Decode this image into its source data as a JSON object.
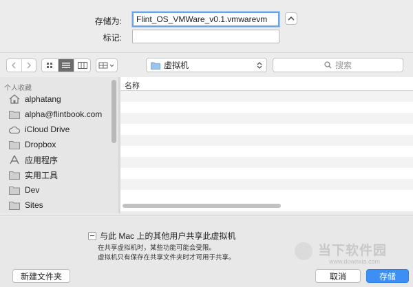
{
  "save": {
    "save_as_label": "存储为:",
    "save_as_value": "Flint_OS_VMWare_v0.1.vmwarevm",
    "tags_label": "标记:",
    "tags_value": ""
  },
  "toolbar": {
    "location": "虚拟机",
    "search_placeholder": "搜索"
  },
  "sidebar": {
    "section": "个人收藏",
    "items": [
      {
        "label": "alphatang",
        "icon": "home-icon"
      },
      {
        "label": "alpha@flintbook.com",
        "icon": "folder-icon"
      },
      {
        "label": "iCloud Drive",
        "icon": "cloud-icon"
      },
      {
        "label": "Dropbox",
        "icon": "folder-icon"
      },
      {
        "label": "应用程序",
        "icon": "applications-icon"
      },
      {
        "label": "实用工具",
        "icon": "folder-icon"
      },
      {
        "label": "Dev",
        "icon": "folder-icon"
      },
      {
        "label": "Sites",
        "icon": "folder-icon"
      }
    ]
  },
  "list": {
    "column_name": "名称"
  },
  "share": {
    "checkbox_label": "与此 Mac 上的其他用户共享此虚拟机",
    "note_line1": "在共享虚拟机时，某些功能可能会受限。",
    "note_line2": "虚拟机只有保存在共享文件夹时才可用于共享。"
  },
  "buttons": {
    "new_folder": "新建文件夹",
    "cancel": "取消",
    "save": "存储"
  },
  "watermark": {
    "brand": "当下软件园",
    "url": "www.downxia.com"
  },
  "colors": {
    "accent": "#3d8ff5",
    "focus_ring": "#6aa4e6",
    "folder": "#9cc4ea"
  }
}
